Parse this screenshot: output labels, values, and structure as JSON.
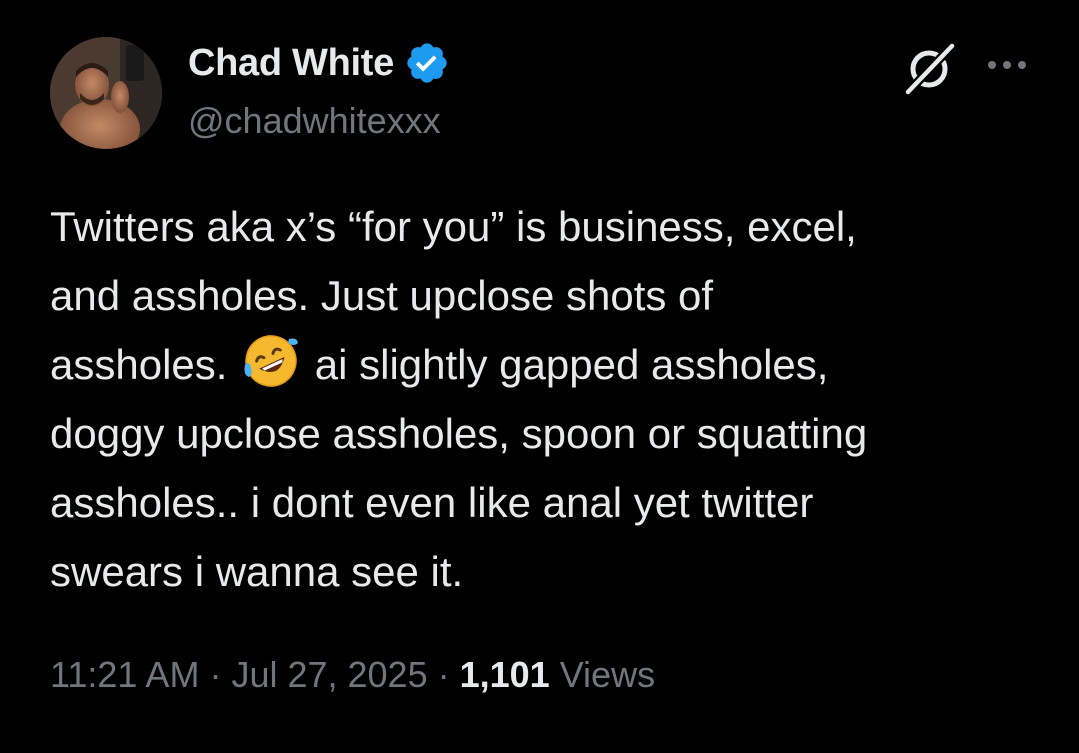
{
  "author": {
    "display_name": "Chad White",
    "handle": "@chadwhitexxx",
    "verified": true
  },
  "icons": {
    "verified": "verified-badge-icon",
    "grok": "grok-icon",
    "more": "more-options-icon",
    "emoji": "rolling-on-floor-laughing-emoji"
  },
  "tweet": {
    "text_before_emoji": "Twitters aka x’s “for you” is business, excel,\nand assholes. Just upclose shots of\nassholes. ",
    "text_after_emoji": " ai slightly gapped assholes,\ndoggy upclose assholes, spoon or squatting\nassholes.. i dont even like anal yet twitter\nswears i wanna see it."
  },
  "meta": {
    "time": "11:21 AM",
    "separator": " · ",
    "date": "Jul 27, 2025",
    "views_count": "1,101",
    "views_label": " Views"
  },
  "colors": {
    "background": "#000000",
    "text_primary": "#e7e9ea",
    "text_secondary": "#71767b",
    "verified_blue": "#1d9bf0"
  }
}
